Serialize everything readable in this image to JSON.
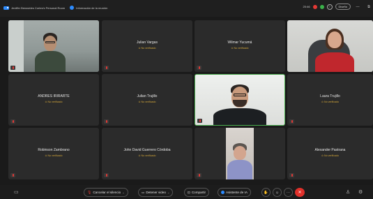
{
  "title_bar": {
    "room_name": "Jeniffer Benavides Cortes's Personal Room",
    "meeting_info": "Información de la reunión",
    "time": "20:46",
    "view_label": "Diseño",
    "minimize": "—",
    "restore": "⧉"
  },
  "status_text": "No verificado",
  "participants": [
    {
      "name": "",
      "has_video": true
    },
    {
      "name": "Julian Vargas",
      "has_video": false
    },
    {
      "name": "Wilmar Yucumá",
      "has_video": false
    },
    {
      "name": "",
      "has_video": true
    },
    {
      "name": "ANDRES IRIRARTE",
      "has_video": false
    },
    {
      "name": "Julian Trujillo",
      "has_video": false
    },
    {
      "name": "",
      "has_video": true
    },
    {
      "name": "Laura Trujillo",
      "has_video": false
    },
    {
      "name": "Robinson Zambrano",
      "has_video": false
    },
    {
      "name": "John David Guerrero Córdoba",
      "has_video": false
    },
    {
      "name": "",
      "has_video": true
    },
    {
      "name": "Alexander Pastrana",
      "has_video": false
    }
  ],
  "toolbar": {
    "unmute": "Cancelar el silencio",
    "stop_video": "Detener video",
    "share": "Compartir",
    "ai_assistant": "Asistente de IA",
    "more": "···"
  },
  "colors": {
    "accent_blue": "#2d8cff",
    "end_red": "#e0302a",
    "status_amber": "#d6a93a",
    "tile_bg": "#2b2b2b"
  }
}
